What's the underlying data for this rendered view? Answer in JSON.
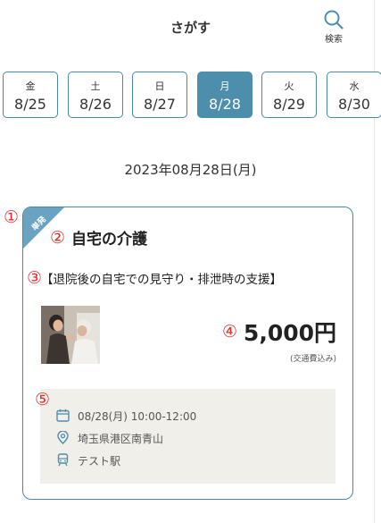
{
  "header": {
    "title": "さがす",
    "search_label": "検索"
  },
  "date_tabs": [
    {
      "dow": "金",
      "md": "8/25",
      "active": false
    },
    {
      "dow": "土",
      "md": "8/26",
      "active": false
    },
    {
      "dow": "日",
      "md": "8/27",
      "active": false
    },
    {
      "dow": "月",
      "md": "8/28",
      "active": true
    },
    {
      "dow": "火",
      "md": "8/29",
      "active": false
    },
    {
      "dow": "水",
      "md": "8/30",
      "active": false
    }
  ],
  "selected_date": "2023年08月28日(月)",
  "annotations": {
    "n1": "①",
    "n2": "②",
    "n3": "③",
    "n4": "④",
    "n5": "⑤"
  },
  "job": {
    "ribbon": "単発",
    "title": "自宅の介護",
    "subtitle": "【退院後の自宅での見守り・排泄時の支援】",
    "price": "5,000円",
    "price_note": "(交通費込み)",
    "datetime": "08/28(月) 10:00-12:00",
    "address": "埼玉県港区南青山",
    "station": "テスト駅"
  },
  "colors": {
    "accent": "#4e8ead",
    "annotation": "#e03030",
    "info_bg": "#f0efea"
  },
  "icons": [
    "search-icon",
    "calendar-icon",
    "map-pin-icon",
    "train-icon"
  ]
}
